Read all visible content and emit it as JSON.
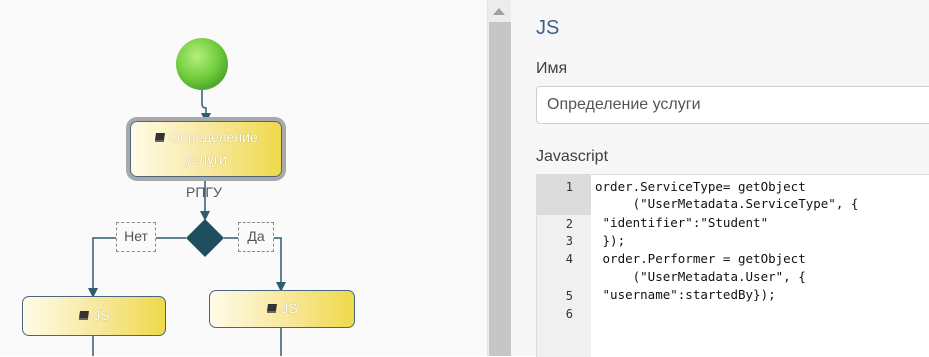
{
  "diagram": {
    "start_node": {
      "color": "#6cc93a"
    },
    "nodes": {
      "define_service": {
        "lines": [
          "Определение",
          "услуги"
        ]
      },
      "js_left": {
        "label": "JS"
      },
      "js_right": {
        "label": "JS"
      }
    },
    "rpgu_label": "РПГУ",
    "branch_no": "Нет",
    "branch_yes": "Да",
    "gateway_color": "#1f4f5e"
  },
  "panel": {
    "title": "JS",
    "name_label": "Имя",
    "name_value": "Определение услуги",
    "script_label": "Javascript",
    "code_lines": [
      {
        "num": "1",
        "text": "order.ServiceType= getObject"
      },
      {
        "num": "",
        "text": "     (\"UserMetadata.ServiceType\", {"
      },
      {
        "num": "2",
        "text": " \"identifier\":\"Student\""
      },
      {
        "num": "3",
        "text": " });"
      },
      {
        "num": "4",
        "text": " order.Performer = getObject"
      },
      {
        "num": "",
        "text": "     (\"UserMetadata.User\", {"
      },
      {
        "num": "5",
        "text": " \"username\":startedBy});"
      },
      {
        "num": "6",
        "text": ""
      }
    ]
  },
  "colors": {
    "accent": "#3f5f86",
    "connector": "#2d5c73"
  }
}
